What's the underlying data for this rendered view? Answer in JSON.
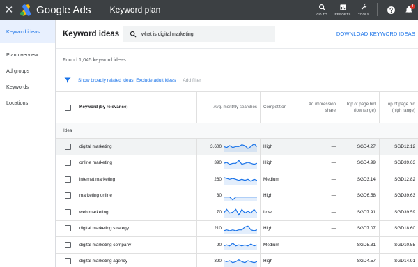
{
  "topbar": {
    "close_glyph": "✕",
    "brand": "Google Ads",
    "page_name": "Keyword plan",
    "tools": [
      {
        "icon": "search-icon",
        "label": "GO TO"
      },
      {
        "icon": "reports-icon",
        "label": "REPORTS"
      },
      {
        "icon": "wrench-icon",
        "label": "TOOLS"
      }
    ],
    "help_icon": "help-icon",
    "notification_badge": "!"
  },
  "sidebar": {
    "items": [
      {
        "label": "Keyword ideas",
        "active": true
      },
      {
        "label": "Plan overview",
        "active": false
      },
      {
        "label": "Ad groups",
        "active": false
      },
      {
        "label": "Keywords",
        "active": false
      },
      {
        "label": "Locations",
        "active": false
      }
    ]
  },
  "main": {
    "title": "Keyword ideas",
    "search_value": "what is digital marketing",
    "download_label": "DOWNLOAD KEYWORD IDEAS",
    "found_text": "Found 1,045 keyword ideas",
    "filter_link": "Show broadly related ideas; Exclude adult ideas",
    "add_filter": "Add filter"
  },
  "table": {
    "headers": {
      "keyword": "Keyword (by relevance)",
      "searches": "Avg. monthly searches",
      "competition": "Competition",
      "impression_share": "Ad impression share",
      "bid_low": "Top of page bid (low range)",
      "bid_high": "Top of page bid (high range)"
    },
    "group_label": "Idea",
    "rows": [
      {
        "keyword": "digital marketing",
        "searches": "3,600",
        "competition": "High",
        "share": "—",
        "low": "SGD4.27",
        "high": "SGD12.12",
        "trend": [
          5,
          4,
          6,
          4,
          5,
          5,
          7,
          6,
          3,
          5,
          8,
          5
        ]
      },
      {
        "keyword": "online marketing",
        "searches": "390",
        "competition": "High",
        "share": "—",
        "low": "SGD4.99",
        "high": "SGD39.63",
        "trend": [
          5,
          6,
          4,
          5,
          5,
          8,
          4,
          5,
          6,
          5,
          4,
          5
        ]
      },
      {
        "keyword": "internet marketing",
        "searches": "260",
        "competition": "Medium",
        "share": "—",
        "low": "SGD3.14",
        "high": "SGD12.82",
        "trend": [
          7,
          6,
          5,
          6,
          5,
          4,
          5,
          4,
          5,
          3,
          5,
          4
        ]
      },
      {
        "keyword": "marketing online",
        "searches": "30",
        "competition": "High",
        "share": "—",
        "low": "SGD6.58",
        "high": "SGD39.63",
        "trend": [
          4,
          4,
          4,
          1,
          4,
          4,
          4,
          4,
          4,
          4,
          4,
          4
        ]
      },
      {
        "keyword": "web marketing",
        "searches": "70",
        "competition": "Low",
        "share": "—",
        "low": "SGD7.91",
        "high": "SGD39.59",
        "trend": [
          4,
          8,
          4,
          5,
          8,
          2,
          8,
          4,
          6,
          4,
          8,
          4
        ]
      },
      {
        "keyword": "digital marketing strategy",
        "searches": "210",
        "competition": "High",
        "share": "—",
        "low": "SGD7.07",
        "high": "SGD18.60",
        "trend": [
          3,
          4,
          3,
          4,
          3,
          4,
          4,
          7,
          8,
          4,
          3,
          4
        ]
      },
      {
        "keyword": "digital marketing company",
        "searches": "90",
        "competition": "Medium",
        "share": "—",
        "low": "SGD5.31",
        "high": "SGD10.55",
        "trend": [
          4,
          5,
          4,
          7,
          4,
          5,
          4,
          5,
          4,
          6,
          4,
          5
        ]
      },
      {
        "keyword": "digital marketing agency",
        "searches": "390",
        "competition": "High",
        "share": "—",
        "low": "SGD4.57",
        "high": "SGD14.91",
        "trend": [
          6,
          5,
          6,
          4,
          5,
          7,
          5,
          4,
          6,
          5,
          4,
          5
        ]
      }
    ]
  },
  "colors": {
    "accent": "#1a73e8",
    "topbar": "#3c4043",
    "sparkline": "#1a73e8",
    "notification": "#d93025"
  }
}
